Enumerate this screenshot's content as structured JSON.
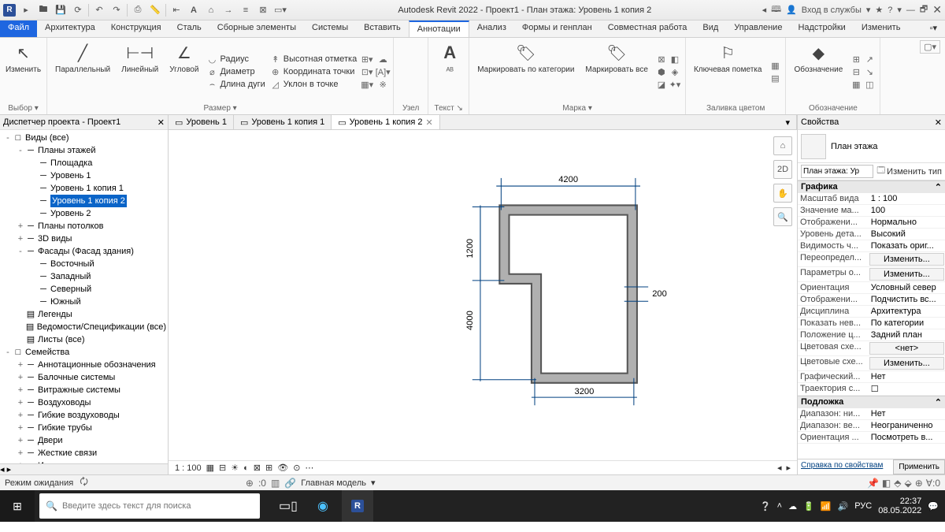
{
  "title": "Autodesk Revit 2022 - Проект1 - План этажа: Уровень 1 копия 2",
  "title_right": {
    "search": "Вход в службы",
    "help": "?"
  },
  "tabs": [
    "Файл",
    "Архитектура",
    "Конструкция",
    "Сталь",
    "Сборные элементы",
    "Системы",
    "Вставить",
    "Аннотации",
    "Анализ",
    "Формы и генплан",
    "Совместная работа",
    "Вид",
    "Управление",
    "Надстройки",
    "Изменить"
  ],
  "tabs_active": 7,
  "panels": {
    "p1": {
      "btn": "Изменить",
      "title": "Выбор ▾"
    },
    "p2": {
      "btns": [
        "Параллельный",
        "Линейный",
        "Угловой"
      ],
      "mini": [
        "Радиус",
        "Диаметр",
        "Длина дуги",
        "Высотная отметка",
        "Координата точки",
        "Уклон в точке"
      ],
      "title": "Размер ▾"
    },
    "p3": {
      "title": "Узел"
    },
    "p4": {
      "btn": "A",
      "title": "Текст ↘"
    },
    "p5": {
      "b1": "Маркировать по категории",
      "b2": "Маркировать все",
      "title": "Марка ▾"
    },
    "p6": {
      "btn": "Ключевая пометка",
      "title": "Заливка цветом"
    },
    "p7": {
      "btn": "Обозначение",
      "title": "Обозначение"
    }
  },
  "project_browser_title": "Диспетчер проекта - Проект1",
  "tree": [
    {
      "d": 0,
      "e": "-",
      "t": "Виды (все)",
      "ico": "□"
    },
    {
      "d": 1,
      "e": "-",
      "t": "Планы этажей"
    },
    {
      "d": 2,
      "e": "",
      "t": "Площадка"
    },
    {
      "d": 2,
      "e": "",
      "t": "Уровень 1"
    },
    {
      "d": 2,
      "e": "",
      "t": "Уровень 1 копия 1"
    },
    {
      "d": 2,
      "e": "",
      "t": "Уровень 1 копия 2",
      "sel": true
    },
    {
      "d": 2,
      "e": "",
      "t": "Уровень 2"
    },
    {
      "d": 1,
      "e": "+",
      "t": "Планы потолков"
    },
    {
      "d": 1,
      "e": "+",
      "t": "3D виды"
    },
    {
      "d": 1,
      "e": "-",
      "t": "Фасады (Фасад здания)"
    },
    {
      "d": 2,
      "e": "",
      "t": "Восточный"
    },
    {
      "d": 2,
      "e": "",
      "t": "Западный"
    },
    {
      "d": 2,
      "e": "",
      "t": "Северный"
    },
    {
      "d": 2,
      "e": "",
      "t": "Южный"
    },
    {
      "d": 1,
      "e": "",
      "t": "Легенды",
      "ico": "▤"
    },
    {
      "d": 1,
      "e": "",
      "t": "Ведомости/Спецификации (все)",
      "ico": "▤"
    },
    {
      "d": 1,
      "e": "",
      "t": "Листы (все)",
      "ico": "▤"
    },
    {
      "d": 0,
      "e": "-",
      "t": "Семейства",
      "ico": "□"
    },
    {
      "d": 1,
      "e": "+",
      "t": "Аннотационные обозначения"
    },
    {
      "d": 1,
      "e": "+",
      "t": "Балочные системы"
    },
    {
      "d": 1,
      "e": "+",
      "t": "Витражные системы"
    },
    {
      "d": 1,
      "e": "+",
      "t": "Воздуховоды"
    },
    {
      "d": 1,
      "e": "+",
      "t": "Гибкие воздуховоды"
    },
    {
      "d": 1,
      "e": "+",
      "t": "Гибкие трубы"
    },
    {
      "d": 1,
      "e": "+",
      "t": "Двери"
    },
    {
      "d": 1,
      "e": "+",
      "t": "Жесткие связи"
    },
    {
      "d": 1,
      "e": "+",
      "t": "Импосты витража"
    }
  ],
  "viewtabs": [
    {
      "t": "Уровень 1"
    },
    {
      "t": "Уровень 1 копия 1"
    },
    {
      "t": "Уровень 1 копия 2",
      "a": true
    }
  ],
  "dims": {
    "top": "4200",
    "left_up": "1200",
    "left": "4000",
    "right": "200",
    "bot": "3200"
  },
  "view_scale": "1 : 100",
  "properties_title": "Свойства",
  "prop_type": "План этажа",
  "prop_selector": "План этажа: Ур",
  "edit_type": "Изменить тип",
  "prop_groups": [
    {
      "g": "Графика",
      "rows": [
        {
          "k": "Масштаб вида",
          "v": "1 : 100"
        },
        {
          "k": "Значение ма...",
          "v": "100"
        },
        {
          "k": "Отображени...",
          "v": "Нормально"
        },
        {
          "k": "Уровень дета...",
          "v": "Высокий"
        },
        {
          "k": "Видимость ч...",
          "v": "Показать ориг..."
        },
        {
          "k": "Переопредел...",
          "v": "Изменить...",
          "btn": true
        },
        {
          "k": "Параметры о...",
          "v": "Изменить...",
          "btn": true
        },
        {
          "k": "Ориентация",
          "v": "Условный север"
        },
        {
          "k": "Отображени...",
          "v": "Подчистить вс..."
        },
        {
          "k": "Дисциплина",
          "v": "Архитектура"
        },
        {
          "k": "Показать нев...",
          "v": "По категории"
        },
        {
          "k": "Положение ц...",
          "v": "Задний план"
        },
        {
          "k": "Цветовая схе...",
          "v": "<нет>",
          "btn": true
        },
        {
          "k": "Цветовые схе...",
          "v": "Изменить...",
          "btn": true
        },
        {
          "k": "Графический...",
          "v": "Нет"
        },
        {
          "k": "Траектория с...",
          "v": "☐"
        }
      ]
    },
    {
      "g": "Подложка",
      "rows": [
        {
          "k": "Диапазон: ни...",
          "v": "Нет"
        },
        {
          "k": "Диапазон: ве...",
          "v": "Неограниченно"
        },
        {
          "k": "Ориентация ...",
          "v": "Посмотреть в..."
        }
      ]
    }
  ],
  "prop_help": "Справка по свойствам",
  "prop_apply": "Применить",
  "status": "Режим ожидания",
  "status_center": "Главная модель",
  "status_zero": ":0",
  "status_filter": "∀:0",
  "search_placeholder": "Введите здесь текст для поиска",
  "lang": "РУС",
  "time": "22:37",
  "date": "08.05.2022"
}
